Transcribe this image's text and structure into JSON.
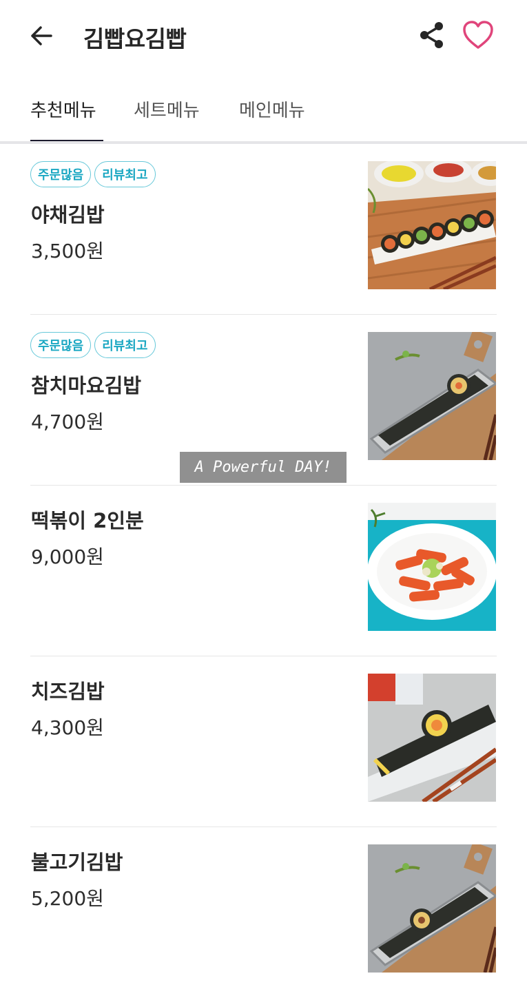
{
  "header": {
    "title": "김빱요김빱",
    "back_icon": "arrow-left-icon",
    "share_icon": "share-icon",
    "favorite_icon": "heart-outline-icon",
    "favorite_color": "#e0457b"
  },
  "tabs": [
    {
      "label": "추천메뉴",
      "active": true
    },
    {
      "label": "세트메뉴",
      "active": false
    },
    {
      "label": "메인메뉴",
      "active": false
    }
  ],
  "menu": [
    {
      "badges": [
        "주문많음",
        "리뷰최고"
      ],
      "name": "야채김밥",
      "price": "3,500원",
      "image": "vegetable-kimbap-photo"
    },
    {
      "badges": [
        "주문많음",
        "리뷰최고"
      ],
      "name": "참치마요김밥",
      "price": "4,700원",
      "image": "tuna-mayo-kimbap-photo"
    },
    {
      "badges": [],
      "name": "떡볶이 2인분",
      "price": "9,000원",
      "image": "tteokbokki-photo"
    },
    {
      "badges": [],
      "name": "치즈김밥",
      "price": "4,300원",
      "image": "cheese-kimbap-photo"
    },
    {
      "badges": [],
      "name": "불고기김밥",
      "price": "5,200원",
      "image": "bulgogi-kimbap-photo"
    }
  ],
  "watermark": "A Powerful DAY!",
  "colors": {
    "badge_text": "#1aa7c2",
    "badge_border": "#66c8d9",
    "tab_indicator": "#1c1b2e"
  }
}
